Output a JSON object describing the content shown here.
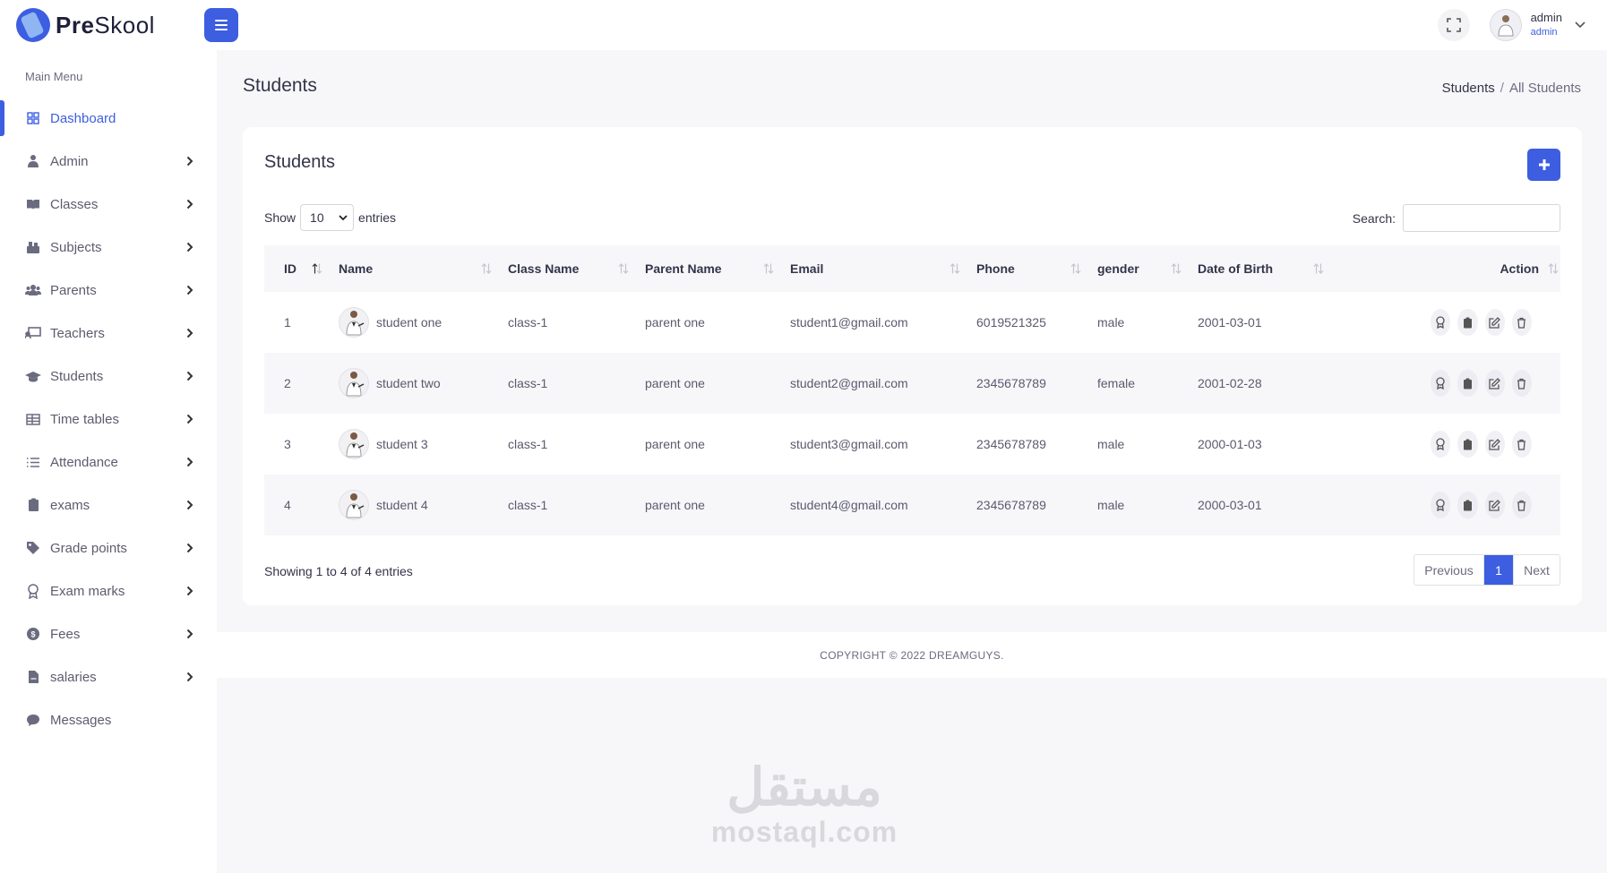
{
  "app": {
    "brand_prefix": "Pre",
    "brand_suffix": "Skool"
  },
  "header": {
    "user_name": "admin",
    "user_role": "admin"
  },
  "sidebar": {
    "title": "Main Menu",
    "items": [
      {
        "label": "Dashboard",
        "icon": "dashboard-icon",
        "active": true,
        "chevron": false
      },
      {
        "label": "Admin",
        "icon": "admin-icon",
        "chevron": true
      },
      {
        "label": "Classes",
        "icon": "book-icon",
        "chevron": true
      },
      {
        "label": "Subjects",
        "icon": "subjects-icon",
        "chevron": true
      },
      {
        "label": "Parents",
        "icon": "users-icon",
        "chevron": true
      },
      {
        "label": "Teachers",
        "icon": "chalkboard-icon",
        "chevron": true
      },
      {
        "label": "Students",
        "icon": "graduation-cap-icon",
        "chevron": true
      },
      {
        "label": "Time tables",
        "icon": "table-icon",
        "chevron": true
      },
      {
        "label": "Attendance",
        "icon": "list-icon",
        "chevron": true
      },
      {
        "label": "exams",
        "icon": "clipboard-icon",
        "chevron": true
      },
      {
        "label": "Grade points",
        "icon": "tag-icon",
        "chevron": true
      },
      {
        "label": "Exam marks",
        "icon": "award-icon",
        "chevron": true
      },
      {
        "label": "Fees",
        "icon": "coin-icon",
        "chevron": true
      },
      {
        "label": "salaries",
        "icon": "file-invoice-icon",
        "chevron": true
      },
      {
        "label": "Messages",
        "icon": "chat-icon",
        "chevron": false
      }
    ]
  },
  "page": {
    "title": "Students",
    "breadcrumb": {
      "parent": "Students",
      "separator": "/",
      "current": "All Students"
    }
  },
  "card": {
    "title": "Students",
    "show_label": "Show",
    "entries_label": "entries",
    "length_value": "10",
    "search_label": "Search:",
    "search_value": "",
    "columns": [
      "ID",
      "Name",
      "Class Name",
      "Parent Name",
      "Email",
      "Phone",
      "gender",
      "Date of Birth",
      "Action"
    ],
    "rows": [
      {
        "id": "1",
        "name": "student one",
        "class": "class-1",
        "parent": "parent one",
        "email": "student1@gmail.com",
        "phone": "6019521325",
        "gender": "male",
        "dob": "2001-03-01"
      },
      {
        "id": "2",
        "name": "student two",
        "class": "class-1",
        "parent": "parent one",
        "email": "student2@gmail.com",
        "phone": "2345678789",
        "gender": "female",
        "dob": "2001-02-28"
      },
      {
        "id": "3",
        "name": "student 3",
        "class": "class-1",
        "parent": "parent one",
        "email": "student3@gmail.com",
        "phone": "2345678789",
        "gender": "male",
        "dob": "2000-01-03"
      },
      {
        "id": "4",
        "name": "student 4",
        "class": "class-1",
        "parent": "parent one",
        "email": "student4@gmail.com",
        "phone": "2345678789",
        "gender": "male",
        "dob": "2000-03-01"
      }
    ],
    "info": "Showing 1 to 4 of 4 entries",
    "pagination": {
      "previous": "Previous",
      "current": "1",
      "next": "Next"
    }
  },
  "footer": {
    "copyright": "COPYRIGHT © 2022 DREAMGUYS."
  },
  "watermark": {
    "arabic": "مستقل",
    "latin": "mostaql.com"
  },
  "colors": {
    "accent": "#3d5ee1",
    "background": "#f7f7fa",
    "text": "#333448"
  }
}
